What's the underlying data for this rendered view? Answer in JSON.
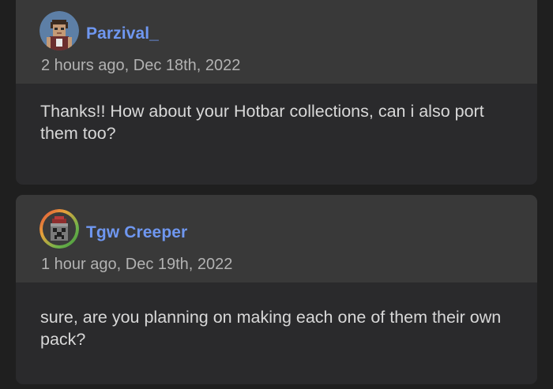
{
  "comments": [
    {
      "username": "Parzival_",
      "timestamp": "2 hours ago, Dec 18th, 2022",
      "text": "Thanks!! How about your Hotbar collections, can i also port them too?",
      "avatar_icon": "pixel-character-avatar-icon"
    },
    {
      "username": "Tgw Creeper",
      "timestamp": "1 hour ago, Dec 19th, 2022",
      "text": "sure, are you planning on making each one of them their own pack?",
      "avatar_icon": "creeper-block-avatar-icon"
    }
  ],
  "colors": {
    "background": "#1f1f1f",
    "card": "#2a2a2c",
    "card_header": "#393939",
    "username": "#6f97f0",
    "timestamp": "#b2b2b2",
    "text": "#d8d8d8"
  }
}
